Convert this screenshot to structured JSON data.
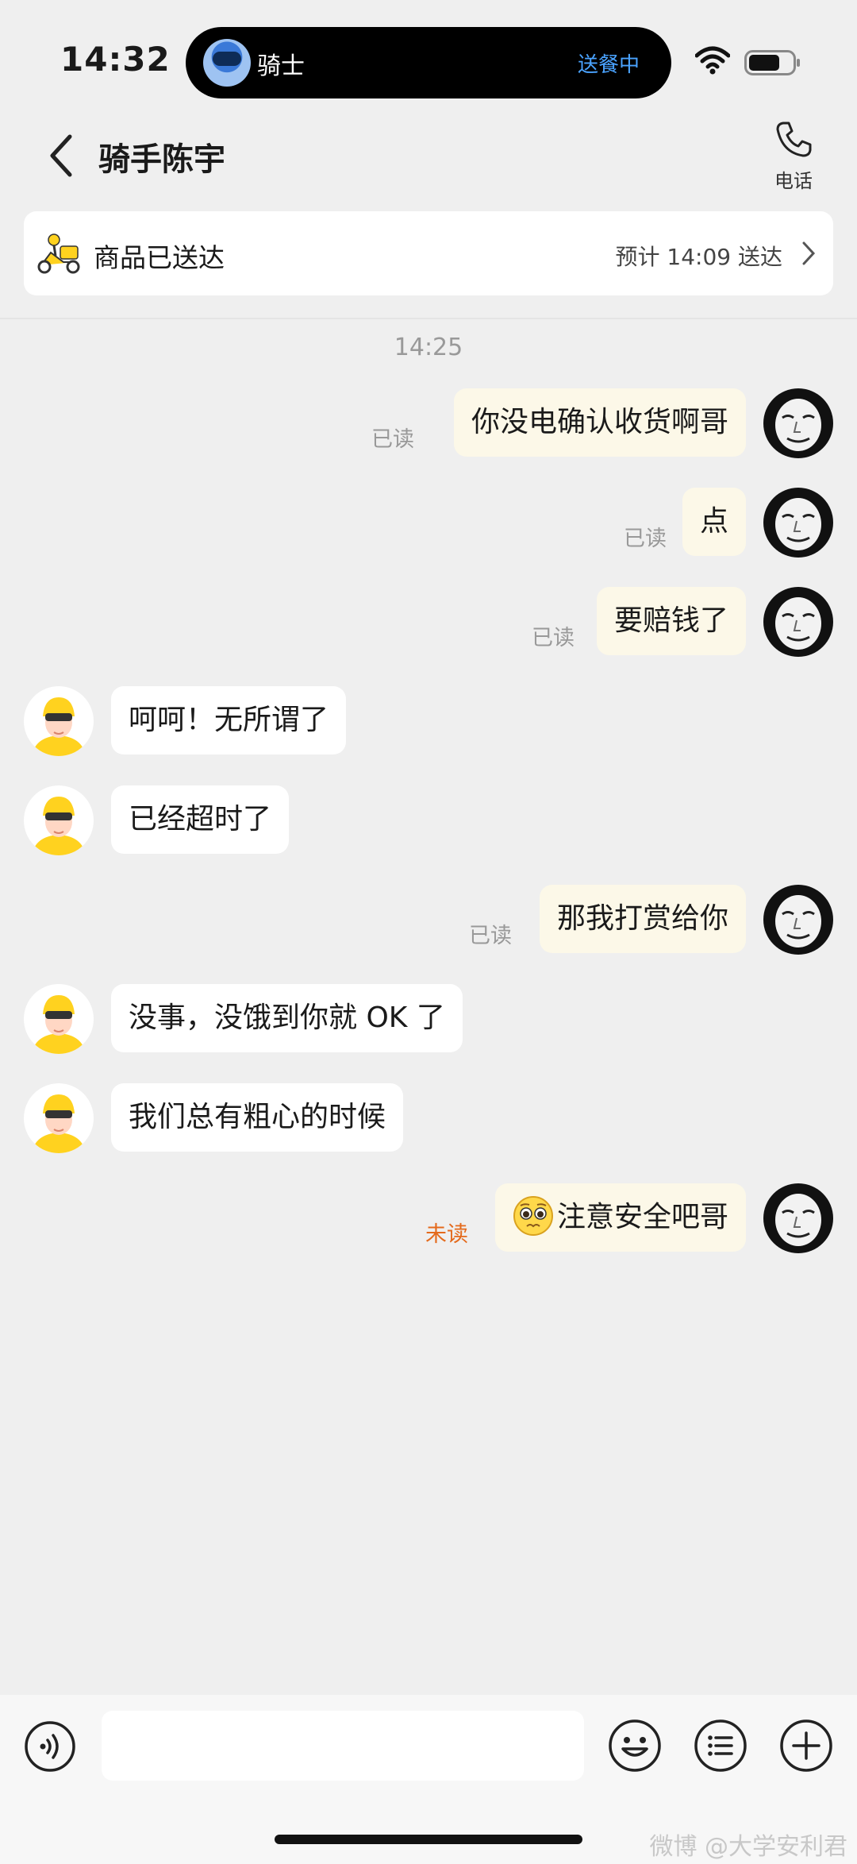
{
  "status_bar": {
    "time": "14:32",
    "live_activity": {
      "name": "骑士",
      "status": "送餐中"
    }
  },
  "header": {
    "title": "骑手陈宇",
    "phone_label": "电话"
  },
  "order": {
    "status": "商品已送达",
    "eta": "预计 14:09 送达"
  },
  "chat": {
    "timestamp": "14:25",
    "messages": [
      {
        "from": "me",
        "text": "你没电确认收货啊哥",
        "read": "已读"
      },
      {
        "from": "me",
        "text": "点",
        "read": "已读"
      },
      {
        "from": "me",
        "text": "要赔钱了",
        "read": "已读"
      },
      {
        "from": "rider",
        "text": "呵呵！无所谓了"
      },
      {
        "from": "rider",
        "text": "已经超时了"
      },
      {
        "from": "me",
        "text": "那我打赏给你",
        "read": "已读"
      },
      {
        "from": "rider",
        "text": "没事，没饿到你就 OK 了"
      },
      {
        "from": "rider",
        "text": "我们总有粗心的时候"
      },
      {
        "from": "me",
        "text": "注意安全吧哥",
        "read": "未读",
        "emoji": "pleading-face-icon"
      }
    ]
  },
  "input_bar": {
    "value": "",
    "placeholder": ""
  },
  "watermark": "微博 @大学安利君",
  "colors": {
    "background": "#efefef",
    "my_bubble": "#fcf8e8",
    "rider_bubble": "#ffffff",
    "unread": "#e46a1c",
    "island_status": "#4aa3ff",
    "rider_avatar_accent": "#ffd21f"
  }
}
